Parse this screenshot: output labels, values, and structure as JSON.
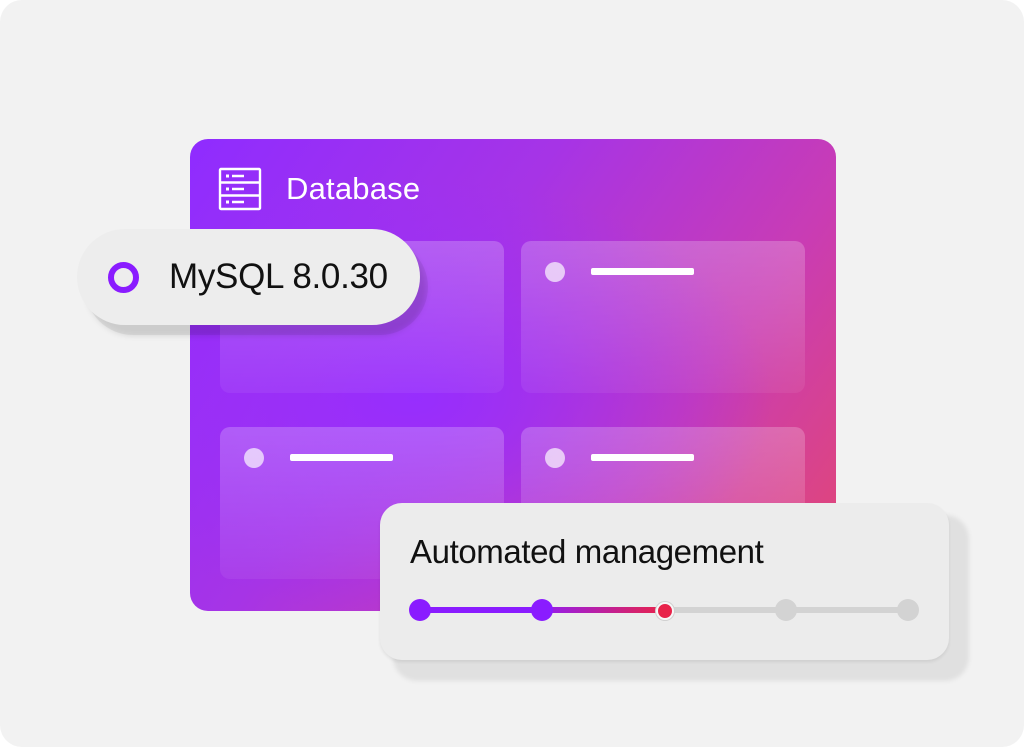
{
  "database_card": {
    "title": "Database",
    "icon": "database-server-icon",
    "tiles": 4
  },
  "version_pill": {
    "label": "MySQL 8.0.30",
    "selected": true
  },
  "management_card": {
    "title": "Automated management",
    "progress": {
      "steps_total": 5,
      "steps_completed": 2,
      "current_step": 3
    }
  },
  "colors": {
    "accent_purple": "#8a1cff",
    "accent_red": "#e8234a",
    "gradient_start": "#8f2cff",
    "gradient_end": "#e4486f",
    "background": "#f2f2f2"
  }
}
